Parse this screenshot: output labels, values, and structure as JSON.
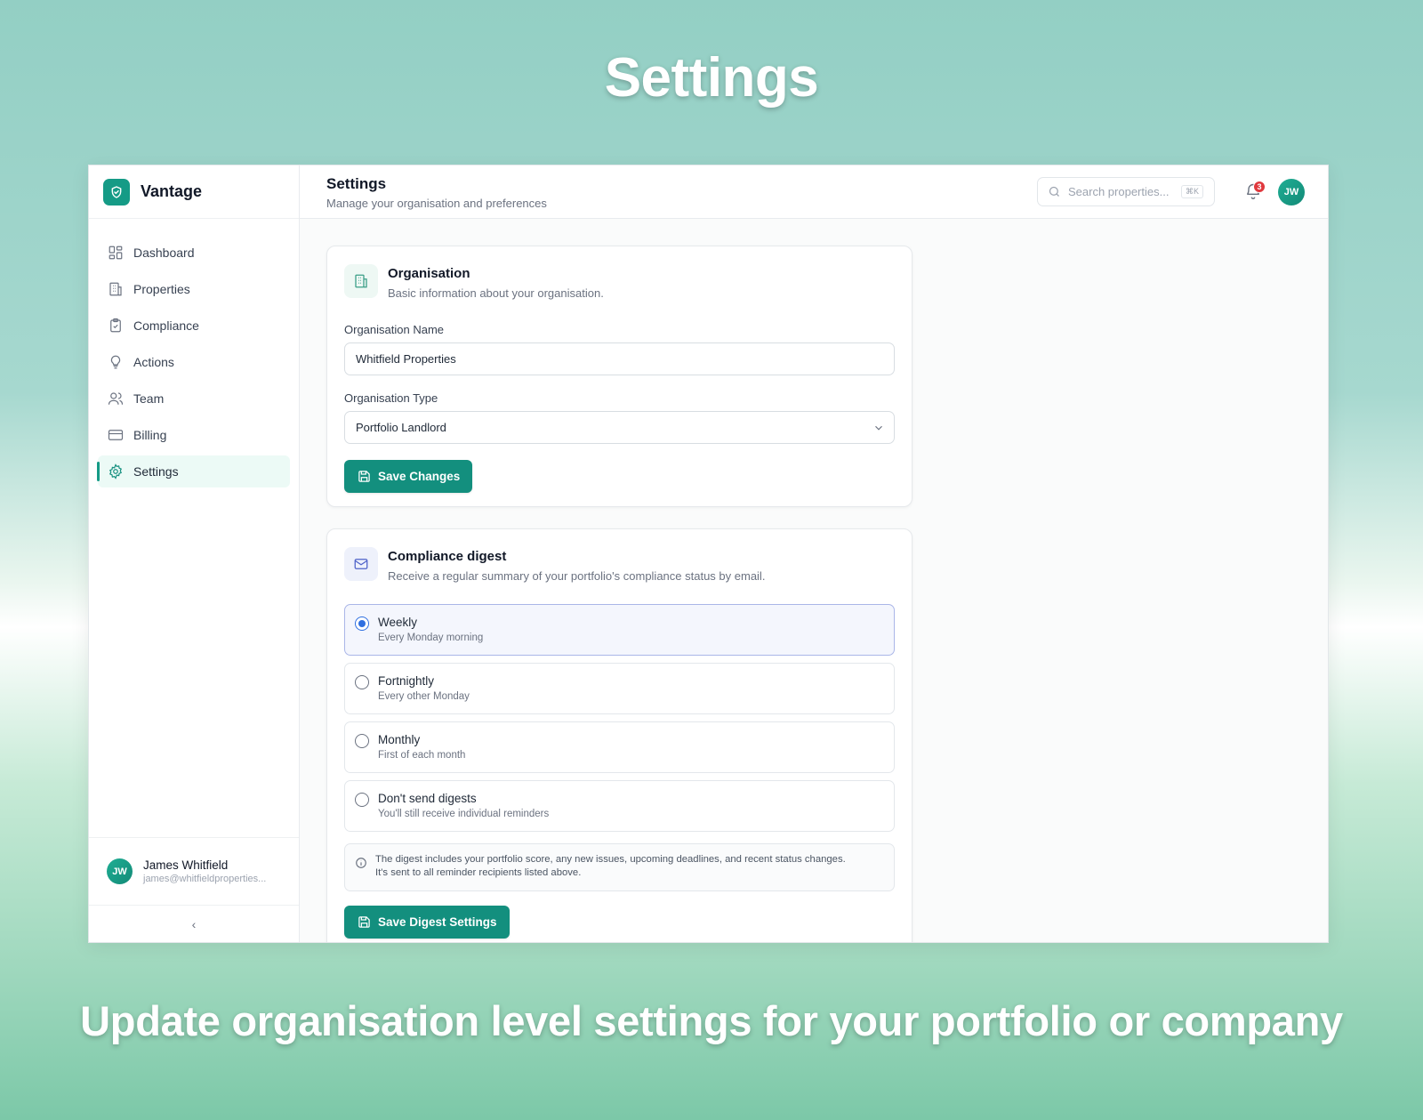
{
  "hero": {
    "title": "Settings",
    "caption": "Update organisation level settings for your portfolio or company"
  },
  "brand": {
    "name": "Vantage",
    "color": "#159b86"
  },
  "sidebar": {
    "items": [
      {
        "label": "Dashboard",
        "icon": "grid-icon"
      },
      {
        "label": "Properties",
        "icon": "building-icon"
      },
      {
        "label": "Compliance",
        "icon": "clipboard-check-icon"
      },
      {
        "label": "Actions",
        "icon": "lightbulb-icon"
      },
      {
        "label": "Team",
        "icon": "users-icon"
      },
      {
        "label": "Billing",
        "icon": "credit-card-icon"
      },
      {
        "label": "Settings",
        "icon": "gear-icon",
        "active": true
      }
    ],
    "user": {
      "initials": "JW",
      "name": "James Whitfield",
      "email": "james@whitfieldproperties..."
    },
    "collapse_icon": "‹"
  },
  "header": {
    "title": "Settings",
    "subtitle": "Manage your organisation and preferences",
    "search_placeholder": "Search properties...",
    "search_shortcut": "⌘K",
    "notification_count": "3",
    "avatar_initials": "JW"
  },
  "organisation": {
    "title": "Organisation",
    "description": "Basic information about your organisation.",
    "name_label": "Organisation Name",
    "name_value": "Whitfield Properties",
    "type_label": "Organisation Type",
    "type_value": "Portfolio Landlord",
    "save_label": "Save Changes"
  },
  "digest": {
    "title": "Compliance digest",
    "description": "Receive a regular summary of your portfolio's compliance status by email.",
    "options": [
      {
        "label": "Weekly",
        "sub": "Every Monday morning",
        "selected": true
      },
      {
        "label": "Fortnightly",
        "sub": "Every other Monday",
        "selected": false
      },
      {
        "label": "Monthly",
        "sub": "First of each month",
        "selected": false
      },
      {
        "label": "Don't send digests",
        "sub": "You'll still receive individual reminders",
        "selected": false
      }
    ],
    "info_line1": "The digest includes your portfolio score, any new issues, upcoming deadlines, and recent status changes.",
    "info_line2": "It's sent to all reminder recipients listed above.",
    "save_label": "Save Digest Settings"
  },
  "colors": {
    "accent": "#138f7e",
    "radio_selected": "#2f6fe0",
    "badge": "#e0393e"
  }
}
